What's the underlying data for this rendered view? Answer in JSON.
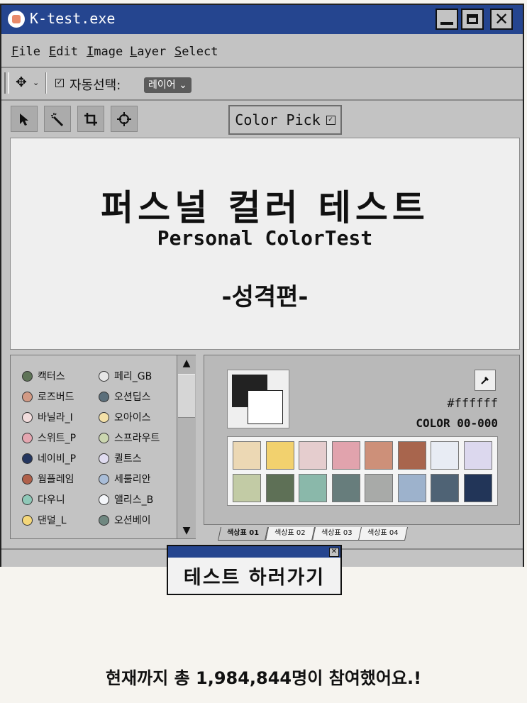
{
  "window": {
    "title": "K-test.exe",
    "controls": {
      "minimize": "minimize-icon",
      "maximize": "maximize-icon",
      "close": "close-icon"
    }
  },
  "menu": [
    "File",
    "Edit",
    "Image",
    "Layer",
    "Select"
  ],
  "options": {
    "auto_select_label": "자동선택:",
    "layer_select_value": "레이어"
  },
  "tools": [
    "arrow-icon",
    "magic-wand-icon",
    "crop-icon",
    "crosshair-icon"
  ],
  "color_pick_label": "Color Pick",
  "canvas": {
    "title": "퍼스널 컬러 테스트",
    "subtitle": "Personal ColorTest",
    "edition": "-성격편-"
  },
  "color_list": [
    {
      "name": "캑터스",
      "color": "#5f7458"
    },
    {
      "name": "페리_GB",
      "color": "#e6e6e6"
    },
    {
      "name": "로즈버드",
      "color": "#d29a85"
    },
    {
      "name": "오션딥스",
      "color": "#5b6f7b"
    },
    {
      "name": "바닐라_I",
      "color": "#f1dcdc"
    },
    {
      "name": "오아이스",
      "color": "#f3e0a8"
    },
    {
      "name": "스위트_P",
      "color": "#e4a6b0"
    },
    {
      "name": "스프라우트",
      "color": "#cbd6b0"
    },
    {
      "name": "네이비_P",
      "color": "#24365f"
    },
    {
      "name": "퀼트스",
      "color": "#e0dcf0"
    },
    {
      "name": "웜플레임",
      "color": "#b0604a"
    },
    {
      "name": "세룰리안",
      "color": "#a9bdd8"
    },
    {
      "name": "다우니",
      "color": "#8fc8b8"
    },
    {
      "name": "앨리스_B",
      "color": "#f4f6fa"
    },
    {
      "name": "댄덜_L",
      "color": "#f4d77a"
    },
    {
      "name": "오션베이",
      "color": "#6f8780"
    }
  ],
  "picker": {
    "foreground": "#222222",
    "background": "#ffffff",
    "hex": "#ffffff",
    "code": "COLOR 00-000"
  },
  "palette": [
    "#ecd8b4",
    "#f2d16e",
    "#e5cdce",
    "#e1a3ad",
    "#cd9079",
    "#a8654d",
    "#e8ecf4",
    "#dcd8ee",
    "#c2cba5",
    "#5e7056",
    "#8ab8aa",
    "#677d7c",
    "#a8aaa8",
    "#9db2cc",
    "#4f6375",
    "#223558"
  ],
  "tabs": [
    "색상표 01",
    "색상표 02",
    "색상표 03",
    "색상표 04"
  ],
  "dialog": {
    "label": "테스트 하러가기"
  },
  "participants_text": "현재까지 총 1,984,844명이 참여했어요.!"
}
